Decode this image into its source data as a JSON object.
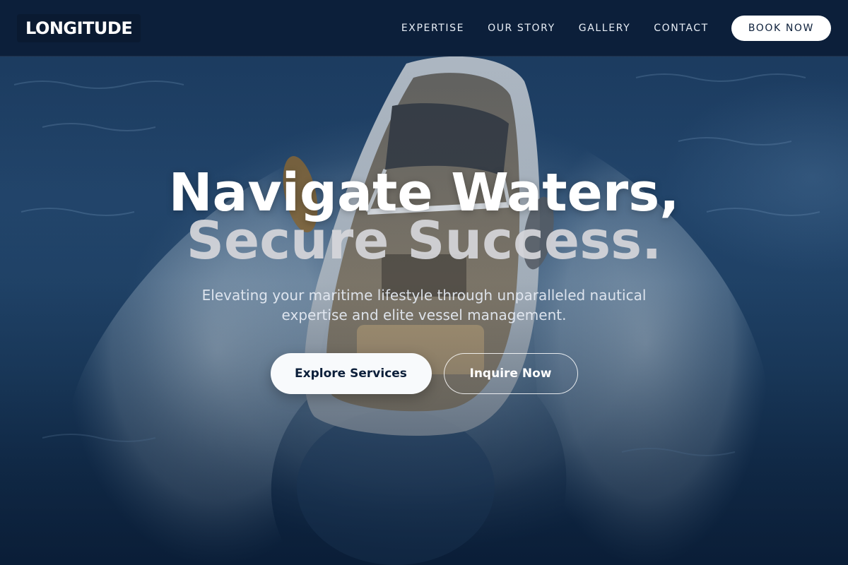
{
  "brand": {
    "logo_text": "LONGITUDE"
  },
  "nav": {
    "links": [
      "EXPERTISE",
      "OUR STORY",
      "GALLERY",
      "CONTACT"
    ],
    "cta_label": "BOOK NOW"
  },
  "hero": {
    "headline_line1": "Navigate Waters,",
    "headline_line2": "Secure Success.",
    "subtitle": "Elevating your maritime lifestyle through unparalleled nautical expertise and elite vessel management.",
    "primary_button": "Explore Services",
    "secondary_button": "Inquire Now",
    "background_image": "aerial-speedboat-wake-photo"
  },
  "colors": {
    "nav_background": "#0c1f3a",
    "ocean_blue": "#24486f",
    "button_light": "#f8fafc",
    "text_white": "#ffffff"
  }
}
